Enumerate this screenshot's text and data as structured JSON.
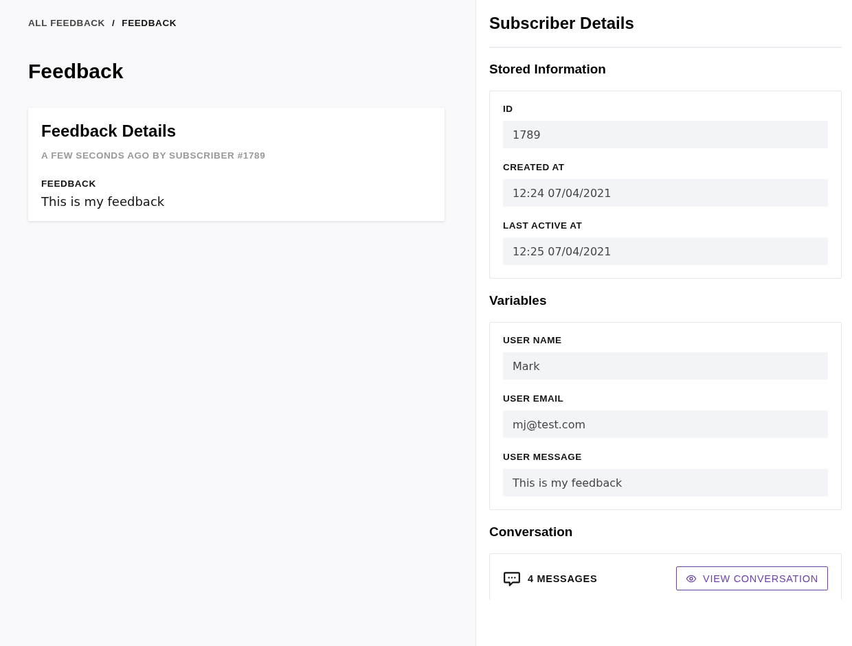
{
  "breadcrumb": [
    {
      "label": "ALL FEEDBACK",
      "current": false
    },
    {
      "label": "FEEDBACK",
      "current": true
    }
  ],
  "breadcrumb_separator": "/",
  "page_title": "Feedback",
  "feedback_card": {
    "title": "Feedback Details",
    "subtitle": "A FEW SECONDS AGO BY SUBSCRIBER #1789",
    "label": "FEEDBACK",
    "text": "This is my feedback"
  },
  "panel": {
    "title": "Subscriber Details",
    "sections": [
      {
        "title": "Stored Information",
        "fields": [
          {
            "label": "ID",
            "value": "1789"
          },
          {
            "label": "CREATED AT",
            "value": "12:24 07/04/2021"
          },
          {
            "label": "LAST ACTIVE AT",
            "value": "12:25 07/04/2021"
          }
        ]
      },
      {
        "title": "Variables",
        "fields": [
          {
            "label": "USER NAME",
            "value": "Mark"
          },
          {
            "label": "USER EMAIL",
            "value": "mj@test.com"
          },
          {
            "label": "USER MESSAGE",
            "value": "This is my feedback"
          }
        ]
      }
    ],
    "conversation": {
      "title": "Conversation",
      "count": "4 MESSAGES",
      "button": "VIEW CONVERSATION"
    }
  }
}
